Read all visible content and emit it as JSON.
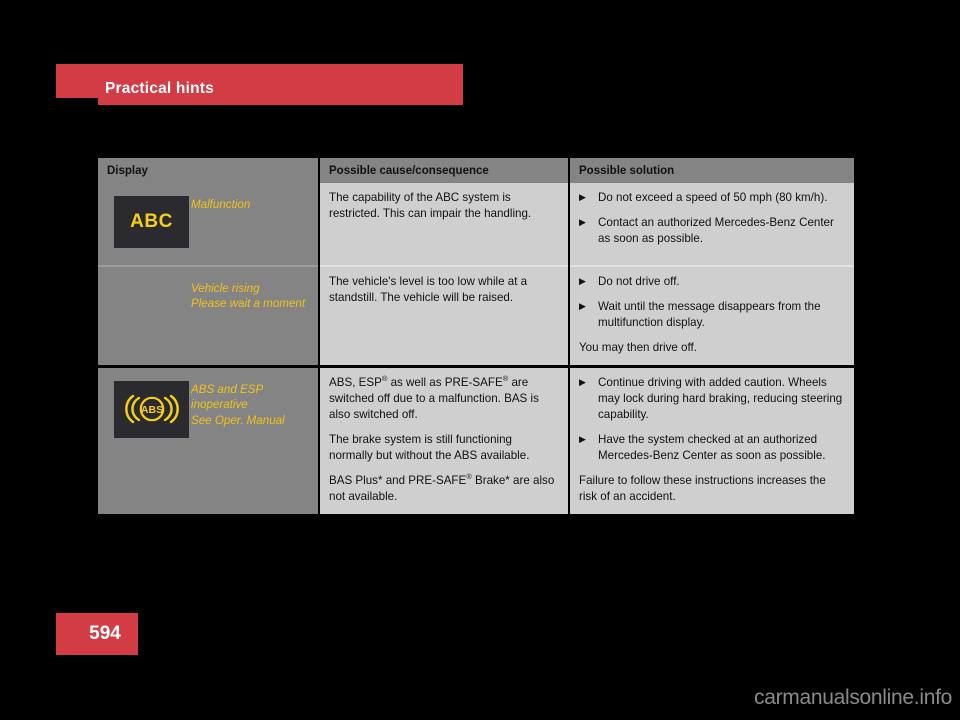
{
  "chapter": {
    "title": "Practical hints",
    "accent_color": "#d33c44"
  },
  "page": {
    "number": "594",
    "background_color": "#000000"
  },
  "watermark": {
    "text": "carmanualsonline.info"
  },
  "table": {
    "columns": [
      {
        "label": "Display"
      },
      {
        "label": "Possible cause/consequence"
      },
      {
        "label": "Possible solution"
      }
    ],
    "rows": [
      {
        "icon": {
          "name": "abc-warning-icon",
          "label": "ABC"
        },
        "messages": [
          "Malfunction"
        ],
        "cause": [
          "The capability of the ABC system is restricted. This can impair the handling."
        ],
        "solution_bullets": [
          "Do not exceed a speed of 50 mph (80 km/h).",
          "Contact an authorized Mercedes-Benz Center as soon as possible."
        ],
        "solution_notes": []
      },
      {
        "icon": null,
        "messages": [
          "Vehicle rising",
          "Please wait a moment"
        ],
        "cause": [
          "The vehicle's level is too low while at a standstill. The vehicle will be raised."
        ],
        "solution_bullets": [
          "Do not drive off.",
          "Wait until the message disappears from the multifunction display."
        ],
        "solution_notes": [
          "You may then drive off."
        ]
      },
      {
        "icon": {
          "name": "abs-warning-icon",
          "label": "ABS"
        },
        "messages": [
          "ABS and ESP",
          "inoperative",
          "See Oper. Manual"
        ],
        "cause_rich": [
          "ABS, ESP® as well as PRE-SAFE® are switched off due to a malfunction. BAS is also switched off.",
          "The brake system is still functioning normally but without the ABS available.",
          "BAS Plus* and PRE-SAFE® Brake* are also not available."
        ],
        "solution_bullets": [
          "Continue driving with added caution. Wheels may lock during hard braking, reducing steering capability.",
          "Have the system checked at an authorized Mercedes-Benz Center as soon as possible."
        ],
        "solution_notes": [
          "Failure to follow these instructions increases the risk of an accident."
        ]
      }
    ],
    "bullet_glyph": "▶",
    "message_color": "#f0c21b",
    "display_bg": "#848484",
    "text_bg": "#cfcfcf"
  }
}
